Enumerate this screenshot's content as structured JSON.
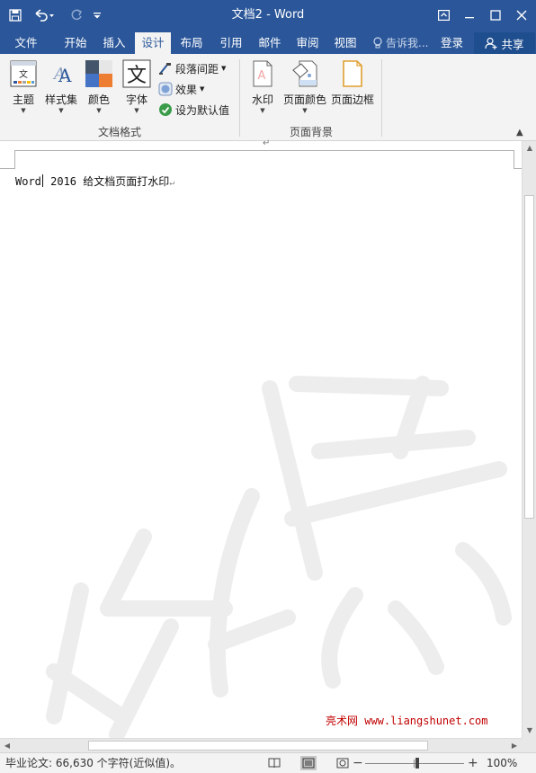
{
  "window": {
    "title": "文档2 - Word"
  },
  "tabs": [
    {
      "label": "文件",
      "active": false
    },
    {
      "label": "开始",
      "active": false
    },
    {
      "label": "插入",
      "active": false
    },
    {
      "label": "设计",
      "active": true
    },
    {
      "label": "布局",
      "active": false
    },
    {
      "label": "引用",
      "active": false
    },
    {
      "label": "邮件",
      "active": false
    },
    {
      "label": "审阅",
      "active": false
    },
    {
      "label": "视图",
      "active": false
    }
  ],
  "tellme": {
    "placeholder": "告诉我..."
  },
  "account": {
    "signin_label": "登录",
    "share_label": "共享"
  },
  "ribbon": {
    "doc_format": {
      "group_label": "文档格式",
      "themes_label": "主题",
      "styleset_label": "样式集",
      "colors_label": "颜色",
      "fonts_label": "字体",
      "paragraph_spacing_label": "段落间距",
      "effects_label": "效果",
      "set_default_label": "设为默认值"
    },
    "page_background": {
      "group_label": "页面背景",
      "watermark_label": "水印",
      "page_color_label": "页面颜色",
      "page_borders_label": "页面边框"
    }
  },
  "document": {
    "text": "Word 2016 给文档页面打水印",
    "text_before_cursor": "Word",
    "text_after_cursor": " 2016 给文档页面打水印",
    "site_watermark": "亮术网 www.liangshunet.com",
    "watermark_color": "#ededed"
  },
  "statusbar": {
    "word_count": "毕业论文: 66,630 个字符(近似值)。",
    "zoom_minus": "−",
    "zoom_plus": "+",
    "zoom_percent": "100%",
    "zoom_level": 1.0
  },
  "colors": {
    "accent": "#2b579a",
    "ribbon_bg": "#f3f3f3",
    "site_link": "#c00000"
  }
}
